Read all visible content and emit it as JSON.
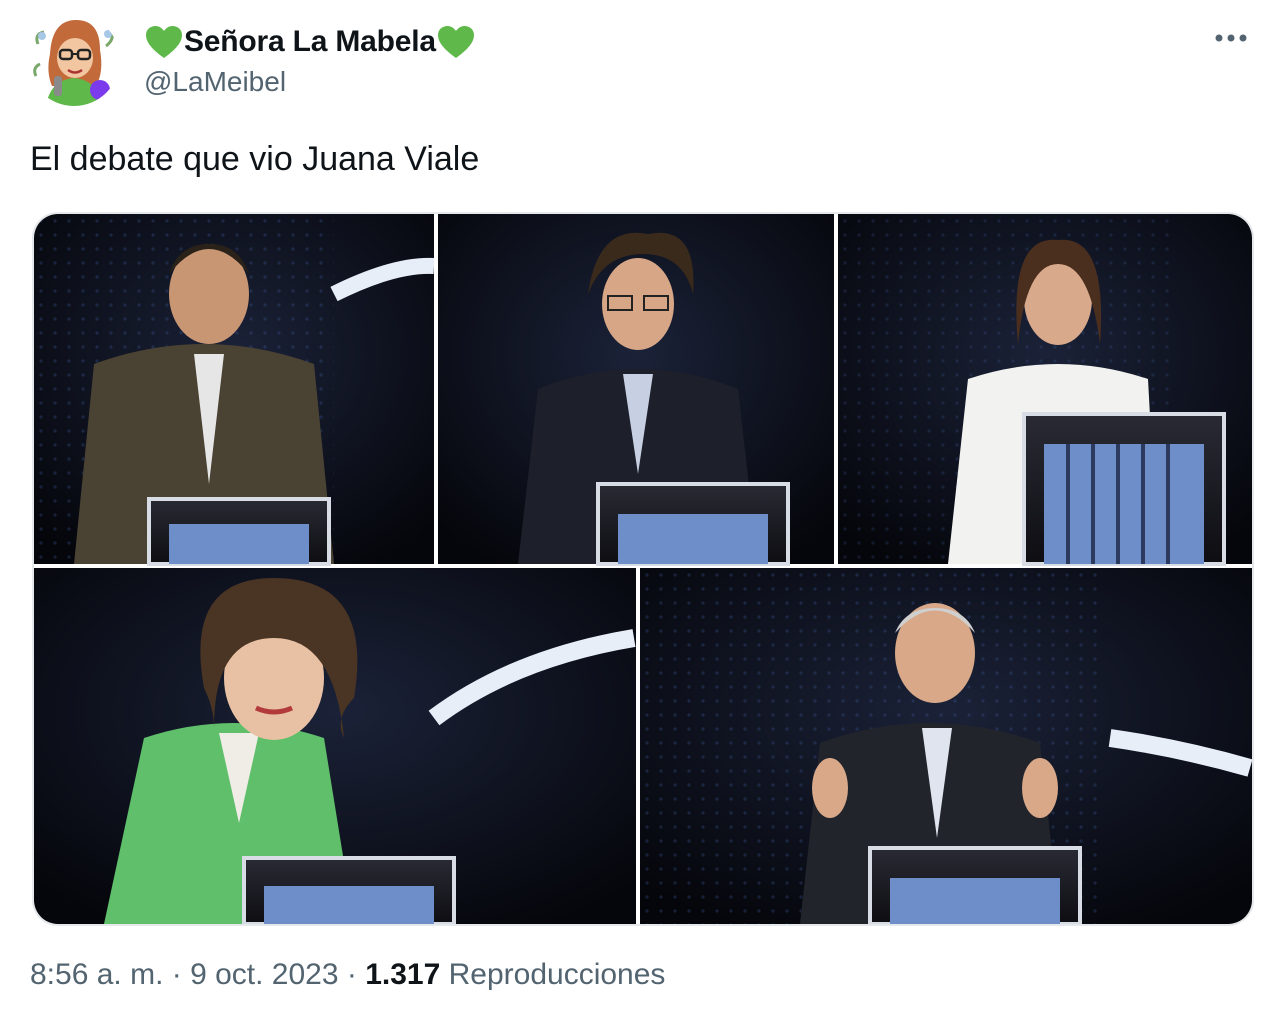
{
  "user": {
    "display_name": "Señora La Mabela",
    "handle": "@LaMeibel",
    "heart_color": "#5fb84a",
    "avatar_icon": "cartoon-woman-avatar"
  },
  "tweet": {
    "text": "El debate que vio Juana Viale",
    "media_description_icon": "debate-collage-image"
  },
  "footer": {
    "time": "8:56 a. m.",
    "separator": " · ",
    "date": "9 oct. 2023",
    "views_count": "1.317",
    "views_label": "Reproducciones"
  },
  "menu": {
    "icon": "more-horizontal-icon"
  }
}
